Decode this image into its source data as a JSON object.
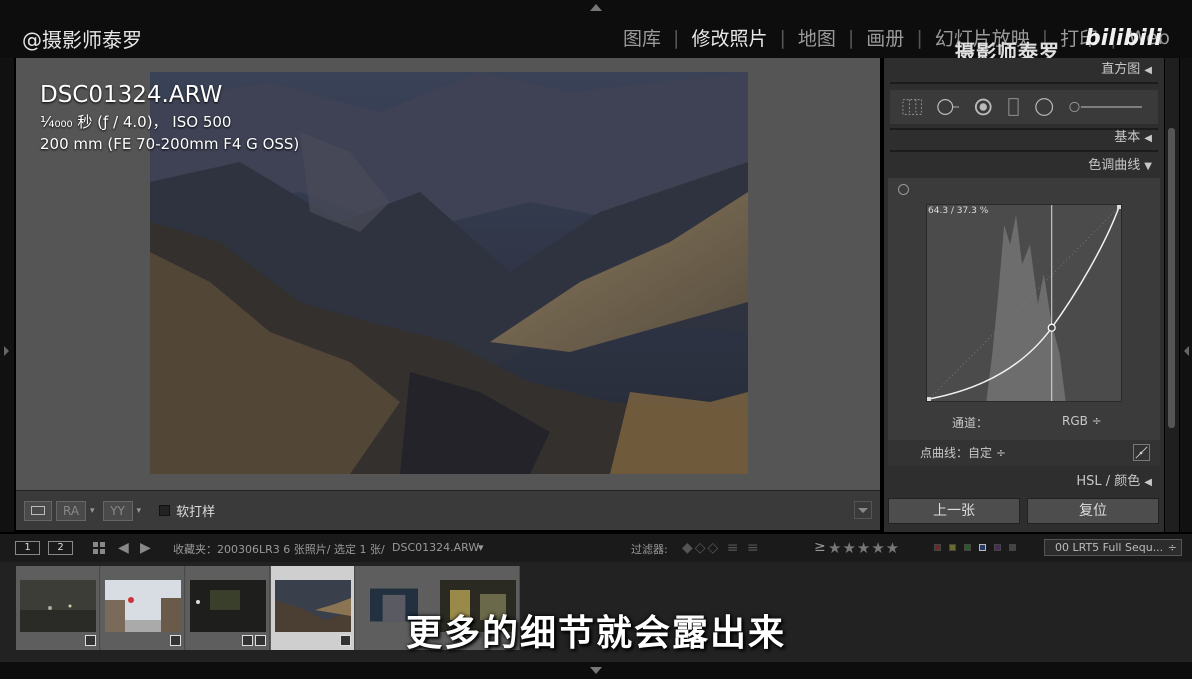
{
  "watermark": "@摄影师泰罗",
  "modules": [
    "图库",
    "修改照片",
    "地图",
    "画册",
    "幻灯片放映",
    "打印",
    "Web"
  ],
  "brand_overlay": "摄影师泰罗",
  "bili_logo": "bilibili",
  "photo_info": {
    "filename": "DSC01324.ARW",
    "exposure_prefix": "¹⁄₄₀₀₀",
    "exposure_rest": " 秒 (ƒ / 4.0)， ISO 500",
    "lens": "200 mm (FE 70-200mm F4 G OSS)"
  },
  "center_toolbar": {
    "ra_label": "RA",
    "yy_label": "YY",
    "caret": "▾",
    "soft_proof_label": "软打样"
  },
  "right_panel": {
    "histogram": "直方图",
    "basic": "基本",
    "tone_curve": "色调曲线",
    "curve_readout": "64.3 / 37.3 %",
    "channel_label": "通道：",
    "channel_value": "RGB ÷",
    "point_curve_label": "点曲线：自定 ÷",
    "hsl": "HSL / 颜色",
    "chev": "◀",
    "chev_down": "▼",
    "prev_button": "上一张",
    "reset_button": "复位"
  },
  "filter_bar": {
    "screen1": "1",
    "screen2": "2",
    "collection_text": "收藏夹：200306LR3   6 张照片/ 选定 1 张/",
    "current_file": "DSC01324.ARW",
    "current_caret": "▾",
    "filter_label": "过滤器:",
    "rating_prefix": "≥",
    "stars": "★★★★★",
    "preset": "00 LRT5 Full Sequ...",
    "preset_caret": "÷"
  },
  "subtitle": "更多的细节就会露出来",
  "colors": {
    "accent_selected_cell": "#cfcfcf",
    "panel_bg": "#2e2e2e",
    "center_bg": "#555555"
  }
}
